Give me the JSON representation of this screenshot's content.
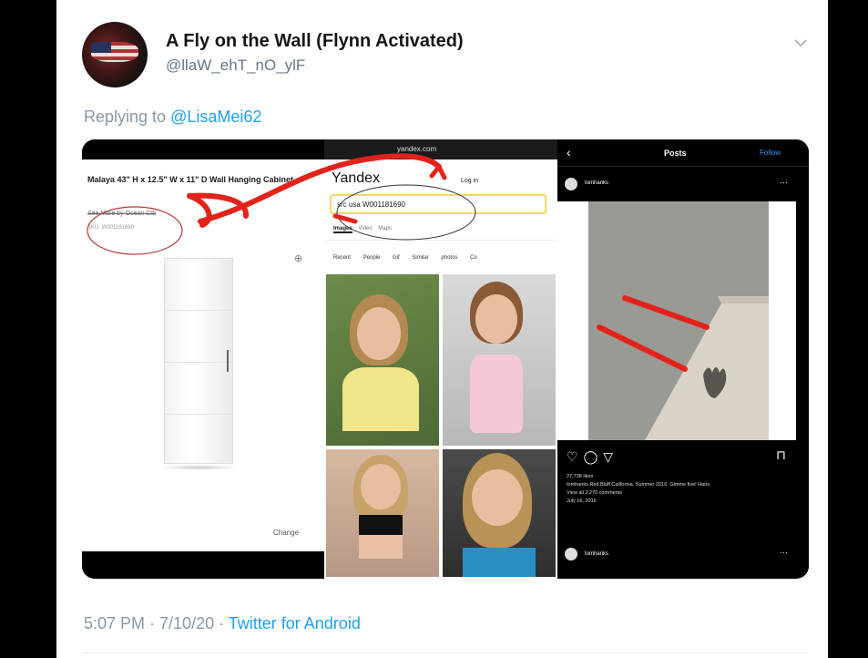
{
  "tweet": {
    "display_name": "A Fly on the Wall (Flynn Activated)",
    "handle": "@llaW_ehT_nO_ylF",
    "reply_prefix": "Replying to",
    "reply_to": "@LisaMei62",
    "timestamp": "5:07 PM · 7/10/20 · ",
    "client": "Twitter for Android"
  },
  "icons": {
    "menu": "chevron-down-icon"
  },
  "colors": {
    "link": "#1da1f2",
    "muted": "#8899a6",
    "annotation": "#e3231b"
  },
  "media": {
    "panel_wayfair": {
      "product_title": "Malaya 43\" H x 12.5\" W x 11\" D Wall Hanging Cabinet",
      "see_more": "See More by Ocean Ctb",
      "sku": "SKU: W001181690",
      "change_label": "Change"
    },
    "panel_yandex": {
      "url": "yandex.com",
      "logo": "Yandex",
      "login": "Log in",
      "query": "src usa W001181690",
      "tabs": [
        "Images",
        "Video",
        "Maps"
      ],
      "filters": [
        "Recent",
        "People",
        "Gif",
        "Similar photos",
        "Co"
      ]
    },
    "panel_instagram": {
      "profile": "tomhanks",
      "header_title": "Posts",
      "follow": "Follow",
      "username": "tomhanks",
      "likes": "27,738 likes",
      "caption": "tomhanks Red Bluff California. Summer 2016. Gimme five! Hanx.",
      "comments": "View all 2,270 comments",
      "date": "July 16, 2016"
    }
  }
}
